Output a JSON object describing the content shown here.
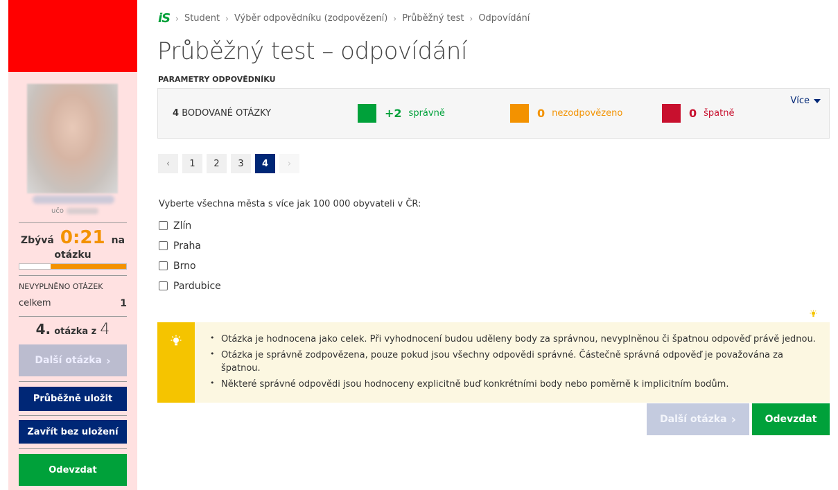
{
  "sidebar": {
    "uco_label": "učo",
    "timer": {
      "prefix": "Zbývá",
      "value": "0:21",
      "suffix": "na",
      "line2": "otázku",
      "progress": 0.71
    },
    "unfilled_title": "NEVYPLNĚNO OTÁZEK",
    "total_label": "celkem",
    "total_value": "1",
    "question_current": "4.",
    "question_mid": "otázka z",
    "question_total": "4",
    "next_label": "Další otázka",
    "save_label": "Průběžně uložit",
    "close_label": "Zavřít bez uložení",
    "submit_label": "Odevzdat"
  },
  "breadcrumb": {
    "logo": "iS",
    "items": [
      "Student",
      "Výběr odpovědníku (zodpovězení)",
      "Průběžný test",
      "Odpovídání"
    ]
  },
  "page_title": "Průběžný test – odpovídání",
  "params": {
    "title": "PARAMETRY ODPOVĚDNÍKU",
    "count": "4",
    "count_label": "BODOVANÉ OTÁZKY",
    "correct_value": "+2",
    "correct_label": "správně",
    "unanswered_value": "0",
    "unanswered_label": "nezodpovězeno",
    "wrong_value": "0",
    "wrong_label": "špatně",
    "more_label": "Více",
    "colors": {
      "correct": "#00a13a",
      "unanswered": "#f39200",
      "wrong": "#c8102e"
    }
  },
  "pager": {
    "prev": "‹",
    "pages": [
      "1",
      "2",
      "3",
      "4"
    ],
    "active": "4",
    "next": "›"
  },
  "question": {
    "text": "Vyberte všechna města s více jak 100 000 obyvateli v ČR:",
    "options": [
      "Zlín",
      "Praha",
      "Brno",
      "Pardubice"
    ]
  },
  "info": {
    "items": [
      "Otázka je hodnocena jako celek. Při vyhodnocení budou uděleny body za správnou, nevyplněnou či špatnou odpověď právě jednou.",
      "Otázka je správně zodpovězena, pouze pokud jsou všechny odpovědi správné. Částečně správná odpověď je považována za špatnou.",
      "Některé správné odpovědi jsou hodnoceny explicitně buď konkrétními body nebo poměrně k implicitním bodům."
    ]
  },
  "actions": {
    "next_label": "Další otázka",
    "submit_label": "Odevzdat"
  }
}
